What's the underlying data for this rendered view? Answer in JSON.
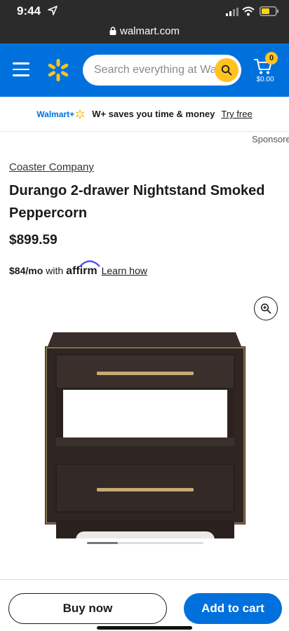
{
  "status_bar": {
    "time": "9:44"
  },
  "browser": {
    "url": "walmart.com"
  },
  "header": {
    "search_placeholder": "Search everything at Walmart",
    "cart_count": "0",
    "cart_total": "$0.00"
  },
  "banner": {
    "logo_text": "Walmart+",
    "tagline": "W+ saves you time & money",
    "link": "Try free"
  },
  "sponsored": "Sponsored",
  "product": {
    "brand": "Coaster Company",
    "title": "Durango 2-drawer Nightstand Smoked Peppercorn",
    "price": "$899.59",
    "affirm_monthly": "$84/mo",
    "affirm_with": "with",
    "affirm_brand": "affirm",
    "affirm_link": "Learn how"
  },
  "carousel": {
    "progress": 0.27
  },
  "footer": {
    "buy_now": "Buy now",
    "add_to_cart": "Add to cart"
  },
  "colors": {
    "brand_blue": "#0071dc",
    "brand_yellow": "#ffc220",
    "dark_bar": "#2b2b2b"
  },
  "icons": [
    "location-arrow-icon",
    "signal-icon",
    "wifi-icon",
    "battery-icon",
    "lock-icon",
    "menu-icon",
    "spark-logo-icon",
    "search-icon",
    "cart-icon",
    "zoom-in-icon"
  ]
}
